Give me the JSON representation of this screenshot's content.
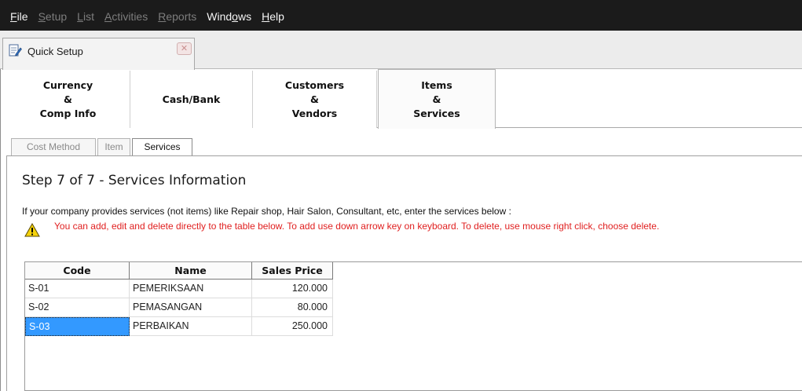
{
  "menu": [
    {
      "label": "File",
      "enabled": true
    },
    {
      "label": "Setup",
      "enabled": false
    },
    {
      "label": "List",
      "enabled": false
    },
    {
      "label": "Activities",
      "enabled": false
    },
    {
      "label": "Reports",
      "enabled": false
    },
    {
      "label": "Windows",
      "enabled": true
    },
    {
      "label": "Help",
      "enabled": true
    }
  ],
  "doc_tab": {
    "title": "Quick Setup",
    "icon": "document-pencil-icon",
    "close": "close-icon",
    "close_glyph": "✕"
  },
  "big_tabs": [
    {
      "label": "Currency\n&\nComp Info",
      "active": false
    },
    {
      "label": "Cash/Bank",
      "active": false
    },
    {
      "label": "Customers\n&\nVendors",
      "active": false
    },
    {
      "label": "Items\n&\nServices",
      "active": true
    }
  ],
  "sub_tabs": [
    {
      "label": "Cost Method",
      "active": false
    },
    {
      "label": "Item",
      "active": false
    },
    {
      "label": "Services",
      "active": true
    }
  ],
  "step": {
    "title": "Step 7 of 7   - Services Information"
  },
  "description": "If your company provides services (not items) like Repair shop, Hair Salon, Consultant, etc, enter the services below :",
  "warning": {
    "icon": "warning-icon",
    "text": "You can add, edit and delete directly to the table below. To add use down arrow key on keyboard. To delete, use mouse right click, choose delete.",
    "color": "#e02020"
  },
  "grid": {
    "columns": [
      "Code",
      "Name",
      "Sales Price"
    ],
    "rows": [
      {
        "code": "S-01",
        "name": "PEMERIKSAAN",
        "price": "120.000"
      },
      {
        "code": "S-02",
        "name": "PEMASANGAN",
        "price": "80.000"
      },
      {
        "code": "S-03",
        "name": "PERBAIKAN",
        "price": "250.000",
        "selected": true
      }
    ],
    "selection_color": "#3399ff"
  }
}
